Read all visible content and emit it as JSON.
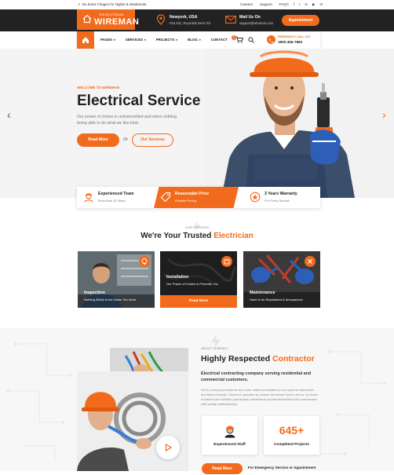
{
  "topbar": {
    "notice": "No Extra Chages for Nights & Weekends.",
    "links": [
      "Careers",
      "Support",
      "FAQ's"
    ]
  },
  "logo": {
    "small": "THE ELECTRICIAN",
    "big": "WIREMAN"
  },
  "header": {
    "location_title": "Newyork, USA",
    "location_detail": "Flat 201, Reynolds Neck Str",
    "mail_title": "Mail Us On",
    "mail_detail": "support@wireman.com",
    "appointment_label": "Appointment"
  },
  "nav": {
    "items": [
      "PAGES",
      "SERVICES",
      "PROJECTS",
      "BLOG",
      "CONTACT"
    ],
    "cart_count": "0",
    "emergency_title": "EMERGENCY CALL 24/7",
    "emergency_number": "1800-456-7890"
  },
  "hero": {
    "subtitle": "WELCOME TO WIREMAN",
    "title": "Electrical Service",
    "text": "Our power of choice is untrammelled and when nothing being able to do what we like best.",
    "primary_button": "Read More",
    "or": "Or",
    "secondary_button": "Our Services"
  },
  "features": [
    {
      "title": "Experienced Team",
      "desc": "More than 10 Years"
    },
    {
      "title": "Reasonable Price",
      "desc": "Flexible Pricing"
    },
    {
      "title": "3 Years Warranty",
      "desc": "For Every Service"
    }
  ],
  "services": {
    "subtitle": "OUR SERVICES",
    "title_main": "We're Your Trusted ",
    "title_accent": "Electrician",
    "cards": [
      {
        "title": "Inspection",
        "desc": "Nothing Which is the Same Too Work"
      },
      {
        "title": "Installation",
        "desc": "Our Power of Choice is Prevents You",
        "button": "Read More"
      },
      {
        "title": "Maintenance",
        "desc": "Have to be Repudiated & Annoyances"
      }
    ]
  },
  "about": {
    "subtitle": "ABOUT COMPANY",
    "title_main": "Highly Respected ",
    "title_accent": "Contractor",
    "lead": "Electrical contracting company serving  residential and commercial customers.",
    "text": "We're pursuing excellence from your initial consultation to our superior warranties and follow-through. Owned & operated by master electrician David Lemon, our team of trained and certified journeyman electricians provide MetroWest MA homeowners with quality craftsmanship.",
    "staff_label": "Experienced Staff",
    "projects_number": "645+",
    "projects_label": "Completed Projects",
    "read_more": "Read More",
    "emergency_note": "For Emergency Service or Appointment"
  },
  "colors": {
    "accent": "#f26b1d",
    "dark": "#222222"
  }
}
